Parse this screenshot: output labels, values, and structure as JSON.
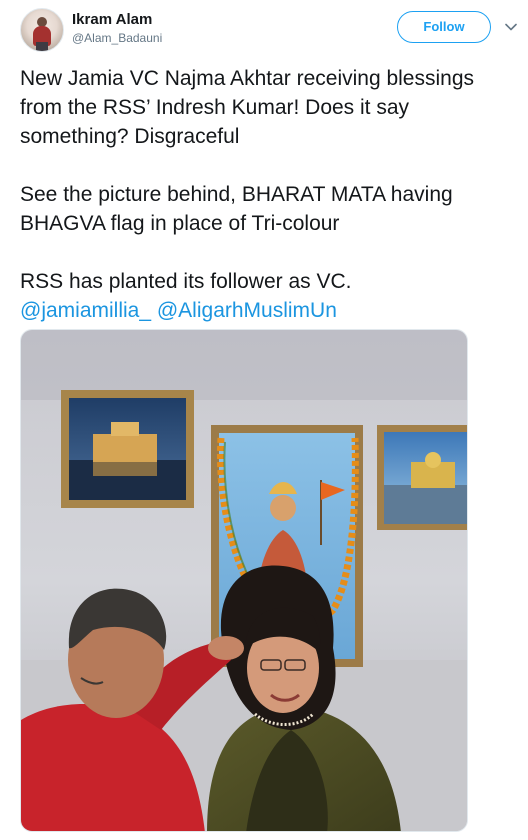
{
  "author": {
    "display_name": "Ikram Alam",
    "handle": "@Alam_Badauni",
    "avatar_icon": "profile-avatar"
  },
  "actions": {
    "follow_label": "Follow",
    "more_icon": "chevron-down-icon"
  },
  "tweet": {
    "line1": "New Jamia VC Najma Akhtar receiving blessings from the RSS’ Indresh Kumar! Does it say something? Disgraceful",
    "line2": "See the picture behind, BHARAT MATA having BHAGVA flag in place of Tri-colour",
    "line3": "RSS has planted its follower as VC.",
    "mention1": "@jamiamillia_",
    "mention2": "@AligarhMuslimUn"
  },
  "colors": {
    "accent": "#1da1f2",
    "link": "#1b95e0",
    "text": "#14171a",
    "secondary": "#657786"
  }
}
